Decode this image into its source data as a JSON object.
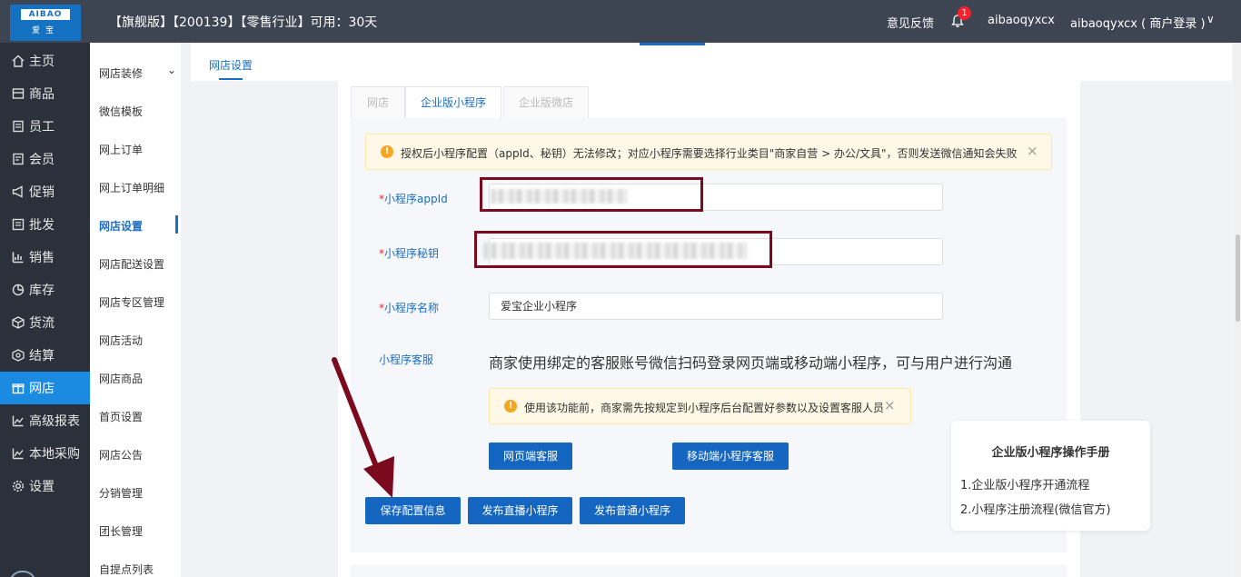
{
  "header": {
    "logo_text": "AIBAO",
    "logo_sub": "爱宝",
    "title": "【旗舰版】【200139】【零售行业】可用：30天",
    "feedback": "意见反馈",
    "notification_count": "1",
    "username": "aibaoqyxcx",
    "account": "aibaoqyxcx ( 商户登录 )"
  },
  "sidebar": {
    "items": [
      {
        "label": "主页",
        "icon": "home-icon"
      },
      {
        "label": "商品",
        "icon": "goods-icon"
      },
      {
        "label": "员工",
        "icon": "staff-icon"
      },
      {
        "label": "会员",
        "icon": "member-icon"
      },
      {
        "label": "促销",
        "icon": "promo-icon"
      },
      {
        "label": "批发",
        "icon": "wholesale-icon"
      },
      {
        "label": "销售",
        "icon": "sales-icon"
      },
      {
        "label": "库存",
        "icon": "inventory-icon"
      },
      {
        "label": "货流",
        "icon": "logistics-icon"
      },
      {
        "label": "结算",
        "icon": "settlement-icon"
      },
      {
        "label": "网店",
        "icon": "gift-icon",
        "active": true
      },
      {
        "label": "高级报表",
        "icon": "report-icon"
      },
      {
        "label": "本地采购",
        "icon": "purchase-icon"
      },
      {
        "label": "设置",
        "icon": "gear-icon"
      }
    ]
  },
  "subsidebar": {
    "items": [
      "网店装修",
      "微信模板",
      "网上订单",
      "网上订单明细",
      "网店设置",
      "网店配送设置",
      "网店专区管理",
      "网店活动",
      "网店商品",
      "首页设置",
      "网店公告",
      "分销管理",
      "团长管理",
      "自提点列表"
    ],
    "active_index": 4
  },
  "page_tab": "网店设置",
  "content_tabs": [
    "网店",
    "企业版小程序",
    "企业版微店"
  ],
  "warning": "授权后小程序配置（appId、秘钥）无法修改；对应小程序需要选择行业类目\"商家自营 > 办公/文具\"，否则发送微信通知会失败",
  "form": {
    "appid_label": "小程序appId",
    "secret_label": "小程序秘钥",
    "name_label": "小程序名称",
    "name_value": "爱宝企业小程序",
    "service_label": "小程序客服",
    "service_text": "商家使用绑定的客服账号微信扫码登录网页端或移动端小程序，可与用户进行沟通",
    "service_warning": "使用该功能前，商家需先按规定到小程序后台配置好参数以及设置客服人员",
    "web_service_btn": "网页端客服",
    "mobile_service_btn": "移动端小程序客服"
  },
  "actions": {
    "save": "保存配置信息",
    "publish_live": "发布直播小程序",
    "publish_normal": "发布普通小程序"
  },
  "manual": {
    "title": "企业版小程序操作手册",
    "links": [
      "1.企业版小程序开通流程",
      "2.小程序注册流程(微信官方)"
    ]
  }
}
